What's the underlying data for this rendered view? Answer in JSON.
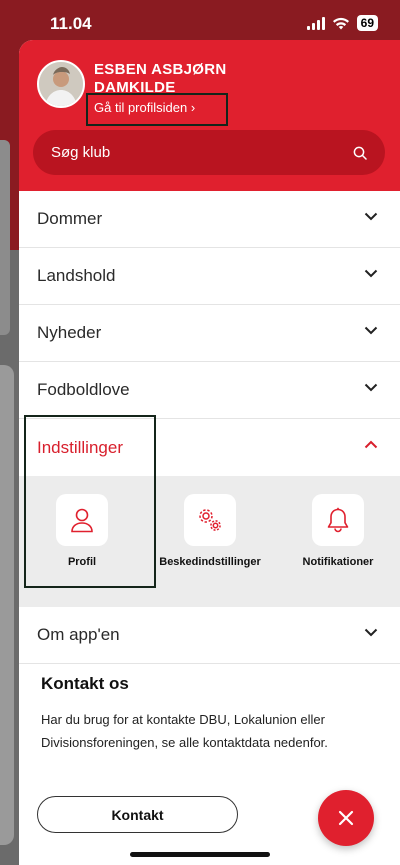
{
  "status_bar": {
    "time": "11.04",
    "battery": "69"
  },
  "user": {
    "name": "ESBEN ASBJØRN DAMKILDE",
    "profile_link": "Gå til profilsiden ›"
  },
  "search": {
    "placeholder": "Søg klub"
  },
  "menu": {
    "items": [
      {
        "label": "Dommer"
      },
      {
        "label": "Landshold"
      },
      {
        "label": "Nyheder"
      },
      {
        "label": "Fodboldlove"
      },
      {
        "label": "Indstillinger"
      },
      {
        "label": "Om app'en"
      }
    ]
  },
  "settings": {
    "tiles": [
      {
        "label": "Profil",
        "icon": "user-icon"
      },
      {
        "label": "Beskedindstillinger",
        "icon": "gears-icon"
      },
      {
        "label": "Notifikationer",
        "icon": "bell-icon"
      }
    ]
  },
  "contact": {
    "title": "Kontakt os",
    "text": "Har du brug for at kontakte DBU, Lokalunion eller Divisionsforeningen, se alle kontaktdata nedenfor.",
    "button": "Kontakt"
  },
  "colors": {
    "brand_red": "#e0202e",
    "dark_red": "#b91420"
  }
}
